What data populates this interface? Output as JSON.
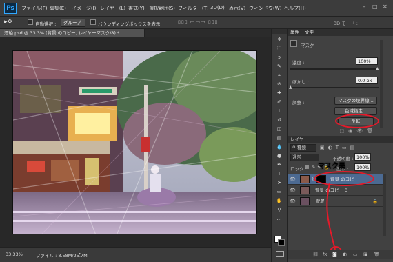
{
  "app": {
    "logo": "Ps"
  },
  "menu": [
    "ファイル(F)",
    "編集(E)",
    "イメージ(I)",
    "レイヤー(L)",
    "書式(Y)",
    "選択範囲(S)",
    "フィルター(T)",
    "3D(D)",
    "表示(V)",
    "ウィンドウ(W)",
    "ヘルプ(H)"
  ],
  "options": {
    "auto_select_label": "自動選択 :",
    "group_value": "グループ",
    "bbox_label": "バウンディングボックスを表示",
    "mode3d_label": "3D モード :"
  },
  "document": {
    "tab_title": "酒粕.psd @ 33.3% (背景 のコピー, レイヤーマスク/8) *",
    "zoom": "33.33%",
    "file_info": "ファイル : 8.58M/25.7M"
  },
  "properties": {
    "tabs": [
      "属性",
      "文字"
    ],
    "mask_label": "マスク",
    "density_label": "濃度 :",
    "density_value": "100%",
    "feather_label": "ぼかし :",
    "feather_value": "0.0 px",
    "refine_label": "調整 :",
    "mask_edge_button": "マスクの境界線...",
    "color_range_button": "色域指定...",
    "invert_button": "反転"
  },
  "layers": {
    "tab": "レイヤー",
    "kind_filter": "種類",
    "blend_mode": "通常",
    "opacity_label": "不透明度 :",
    "opacity_value": "100%",
    "lock_label": "ロック :",
    "fill_label": "塗り :",
    "fill_value": "100%",
    "annotation": "マスク黒",
    "rows": [
      {
        "name": "背景 のコピー",
        "selected": true
      },
      {
        "name": "背景 のコピー 3",
        "selected": false
      },
      {
        "name": "背景",
        "selected": false
      }
    ]
  },
  "colors": {
    "accent_red": "#e41a2a",
    "selected_layer": "#4c6a92"
  }
}
